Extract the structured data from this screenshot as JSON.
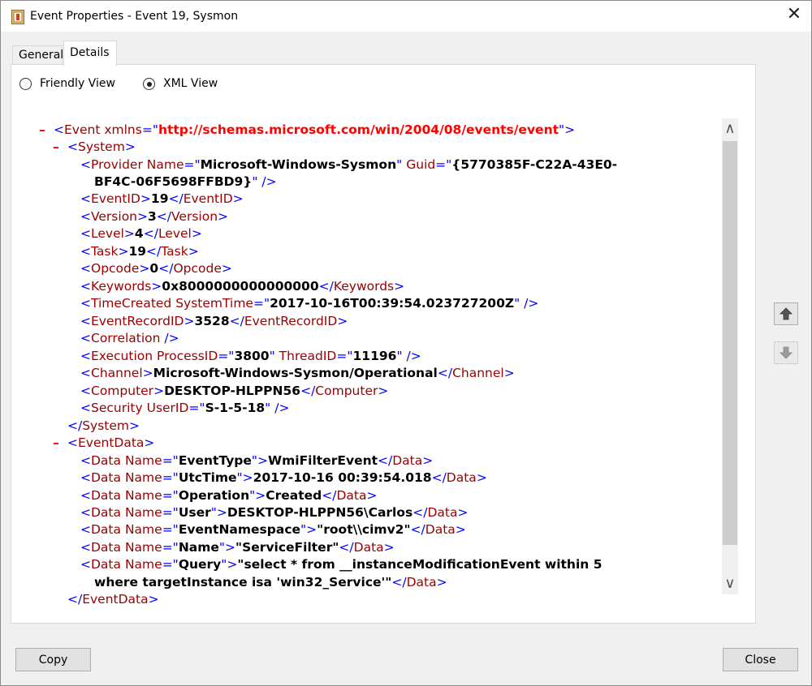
{
  "window": {
    "title": "Event Properties - Event 19, Sysmon",
    "close_glyph": "✕"
  },
  "tabs": [
    {
      "label": "General",
      "selected": false
    },
    {
      "label": "Details",
      "selected": true
    }
  ],
  "view_options": {
    "friendly_label": "Friendly View",
    "xml_label": "XML View",
    "selected": "XML View"
  },
  "xml": {
    "minus": "–",
    "event": {
      "tag": "Event",
      "xmlns_attr": "xmlns",
      "xmlns_value": "http://schemas.microsoft.com/win/2004/08/events/event"
    },
    "system": {
      "tag": "System",
      "provider": {
        "tag": "Provider",
        "name_attr": "Name",
        "name_value": "Microsoft-Windows-Sysmon",
        "guid_attr": "Guid",
        "guid_value_line1": "{5770385F-C22A-43E0-",
        "guid_value_line2": "BF4C-06F5698FFBD9}"
      },
      "fields": [
        {
          "tag": "EventID",
          "value": "19"
        },
        {
          "tag": "Version",
          "value": "3"
        },
        {
          "tag": "Level",
          "value": "4"
        },
        {
          "tag": "Task",
          "value": "19"
        },
        {
          "tag": "Opcode",
          "value": "0"
        },
        {
          "tag": "Keywords",
          "value": "0x8000000000000000"
        }
      ],
      "time_created": {
        "tag": "TimeCreated",
        "attr": "SystemTime",
        "value": "2017-10-16T00:39:54.023727200Z"
      },
      "event_record_id": {
        "tag": "EventRecordID",
        "value": "3528"
      },
      "correlation": {
        "tag": "Correlation"
      },
      "execution": {
        "tag": "Execution",
        "pid_attr": "ProcessID",
        "pid_value": "3800",
        "tid_attr": "ThreadID",
        "tid_value": "11196"
      },
      "channel": {
        "tag": "Channel",
        "value": "Microsoft-Windows-Sysmon/Operational"
      },
      "computer": {
        "tag": "Computer",
        "value": "DESKTOP-HLPPN56"
      },
      "security": {
        "tag": "Security",
        "attr": "UserID",
        "value": "S-1-5-18"
      }
    },
    "event_data": {
      "tag": "EventData",
      "data_tag": "Data",
      "name_attr": "Name",
      "items": [
        {
          "name": "EventType",
          "value": "WmiFilterEvent"
        },
        {
          "name": "UtcTime",
          "value": "2017-10-16 00:39:54.018"
        },
        {
          "name": "Operation",
          "value": "Created"
        },
        {
          "name": "User",
          "value": "DESKTOP-HLPPN56\\Carlos"
        },
        {
          "name": "EventNamespace",
          "value": "\"root\\\\cimv2\""
        },
        {
          "name": "Name",
          "value": "\"ServiceFilter\""
        }
      ],
      "query": {
        "name": "Query",
        "value_line1": "\"select * from __instanceModificationEvent within 5",
        "value_line2": "where targetInstance isa 'win32_Service'\""
      }
    }
  },
  "scrollbar": {
    "up_glyph": "∧",
    "down_glyph": "∨"
  },
  "buttons": {
    "copy": "Copy",
    "close": "Close"
  }
}
